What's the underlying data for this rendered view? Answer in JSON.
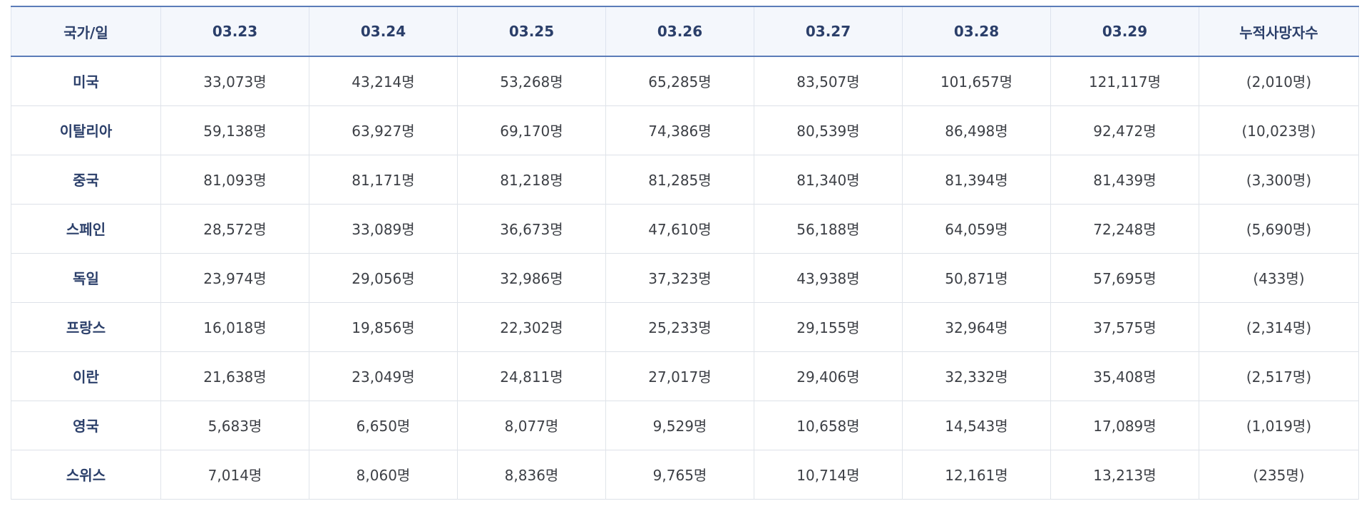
{
  "table": {
    "header": [
      "국가/일",
      "03.23",
      "03.24",
      "03.25",
      "03.26",
      "03.27",
      "03.28",
      "03.29",
      "누적사망자수"
    ],
    "rows": [
      {
        "country": "미국",
        "values": [
          "33,073명",
          "43,214명",
          "53,268명",
          "65,285명",
          "83,507명",
          "101,657명",
          "121,117명"
        ],
        "deaths": "(2,010명)"
      },
      {
        "country": "이탈리아",
        "values": [
          "59,138명",
          "63,927명",
          "69,170명",
          "74,386명",
          "80,539명",
          "86,498명",
          "92,472명"
        ],
        "deaths": "(10,023명)"
      },
      {
        "country": "중국",
        "values": [
          "81,093명",
          "81,171명",
          "81,218명",
          "81,285명",
          "81,340명",
          "81,394명",
          "81,439명"
        ],
        "deaths": "(3,300명)"
      },
      {
        "country": "스페인",
        "values": [
          "28,572명",
          "33,089명",
          "36,673명",
          "47,610명",
          "56,188명",
          "64,059명",
          "72,248명"
        ],
        "deaths": "(5,690명)"
      },
      {
        "country": "독일",
        "values": [
          "23,974명",
          "29,056명",
          "32,986명",
          "37,323명",
          "43,938명",
          "50,871명",
          "57,695명"
        ],
        "deaths": "(433명)"
      },
      {
        "country": "프랑스",
        "values": [
          "16,018명",
          "19,856명",
          "22,302명",
          "25,233명",
          "29,155명",
          "32,964명",
          "37,575명"
        ],
        "deaths": "(2,314명)"
      },
      {
        "country": "이란",
        "values": [
          "21,638명",
          "23,049명",
          "24,811명",
          "27,017명",
          "29,406명",
          "32,332명",
          "35,408명"
        ],
        "deaths": "(2,517명)"
      },
      {
        "country": "영국",
        "values": [
          "5,683명",
          "6,650명",
          "8,077명",
          "9,529명",
          "10,658명",
          "14,543명",
          "17,089명"
        ],
        "deaths": "(1,019명)"
      },
      {
        "country": "스위스",
        "values": [
          "7,014명",
          "8,060명",
          "8,836명",
          "9,765명",
          "10,714명",
          "12,161명",
          "13,213명"
        ],
        "deaths": "(235명)"
      }
    ]
  }
}
